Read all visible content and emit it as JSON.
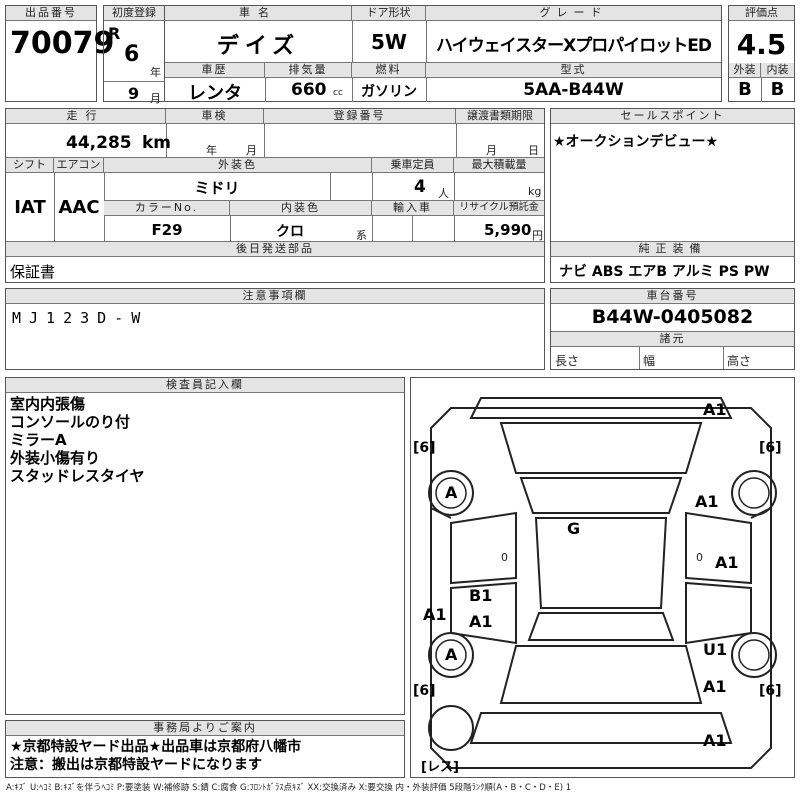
{
  "header": {
    "lot_no_label": "出品番号",
    "lot_no": "70079",
    "first_reg_label": "初度登録",
    "era": "R",
    "year_num": "6",
    "year_unit": "年",
    "month_num": "9",
    "month_unit": "月",
    "car_name_label": "車名",
    "car_name": "デイズ",
    "door_label": "ドア形状",
    "door": "5W",
    "grade_label": "グレード",
    "grade": "ハイウェイスターXプロパイロットED",
    "score_label": "評価点",
    "score": "4.5",
    "history_label": "車歴",
    "history": "レンタ",
    "disp_label": "排気量",
    "disp": "660",
    "disp_unit": "cc",
    "fuel_label": "燃料",
    "fuel": "ガソリン",
    "model_label": "型式",
    "model": "5AA-B44W",
    "ext_label": "外装",
    "ext": "B",
    "int_label": "内装",
    "int": "B"
  },
  "row2": {
    "mileage_label": "走行",
    "mileage": "44,285",
    "mileage_unit": "km",
    "inspect_label": "車検",
    "year_unit": "年",
    "month_unit": "月",
    "regno_label": "登録番号",
    "deadline_label": "譲渡書類期限",
    "deadline_month": "月",
    "deadline_day": "日",
    "shift_label": "シフト",
    "shift": "IAT",
    "ac_label": "エアコン",
    "ac": "AAC",
    "color_label": "外装色",
    "color": "ミドリ",
    "capacity_label": "乗車定員",
    "capacity": "4",
    "capacity_unit": "人",
    "maxload_label": "最大積載量",
    "maxload_unit": "kg",
    "colorno_label": "カラーNo.",
    "colorno": "F29",
    "intcolor_label": "内装色",
    "intcolor": "クロ",
    "intcolor_unit": "系",
    "import_label": "輸入車",
    "recycle_label": "リサイクル預託金",
    "recycle": "5,990",
    "recycle_unit": "円",
    "parts_label": "後日発送部品",
    "parts": "保証書",
    "sales_label": "セールスポイント",
    "sales": "★オークションデビュー★",
    "equip_label": "純正装備",
    "equip": "ナビ ABS エアB アルミ PS PW"
  },
  "notes": {
    "caution_label": "注意事項欄",
    "caution": "MJ123D-W",
    "chassis_label": "車台番号",
    "chassis": "B44W-0405082",
    "dims_label": "諸元",
    "length_label": "長さ",
    "width_label": "幅",
    "height_label": "高さ"
  },
  "inspector": {
    "label": "検査員記入欄",
    "lines": [
      "室内内張傷",
      "コンソールのり付",
      "ミラーA",
      "外装小傷有り",
      "スタッドレスタイヤ"
    ]
  },
  "office": {
    "label": "事務局よりご案内",
    "lines": [
      "★京都特設ヤード出品★出品車は京都府八幡市",
      "注意：搬出は京都特設ヤードになります"
    ]
  },
  "diagram": {
    "marks": {
      "top": "A1",
      "right_front_door": "A1",
      "right_mid": "A1",
      "right_rear": "U1",
      "right_bottom": "A1",
      "bottom": "A1",
      "left_front_tire": "A",
      "left_rear_tire": "A",
      "roof": "G",
      "left_b1": "B1",
      "left_a1": "A1",
      "left_panel": "A1"
    },
    "tire_depths": {
      "fl": "6",
      "fr": "6",
      "rl": "6",
      "rr": "6"
    },
    "spare": "レス",
    "zero": "0"
  },
  "legend": "A:ｷｽﾞ U:ﾍｺﾐ B:ｷｽﾞを伴うﾍｺﾐ P:要塗装 W:補修跡 S:錆 C:腐食 G:ﾌﾛﾝﾄｶﾞﾗｽ点ｷｽﾞ XX:交換済み X:要交換  内・外装評価  5段階ﾗﾝｸ順(A・B・C・D・E) 1"
}
